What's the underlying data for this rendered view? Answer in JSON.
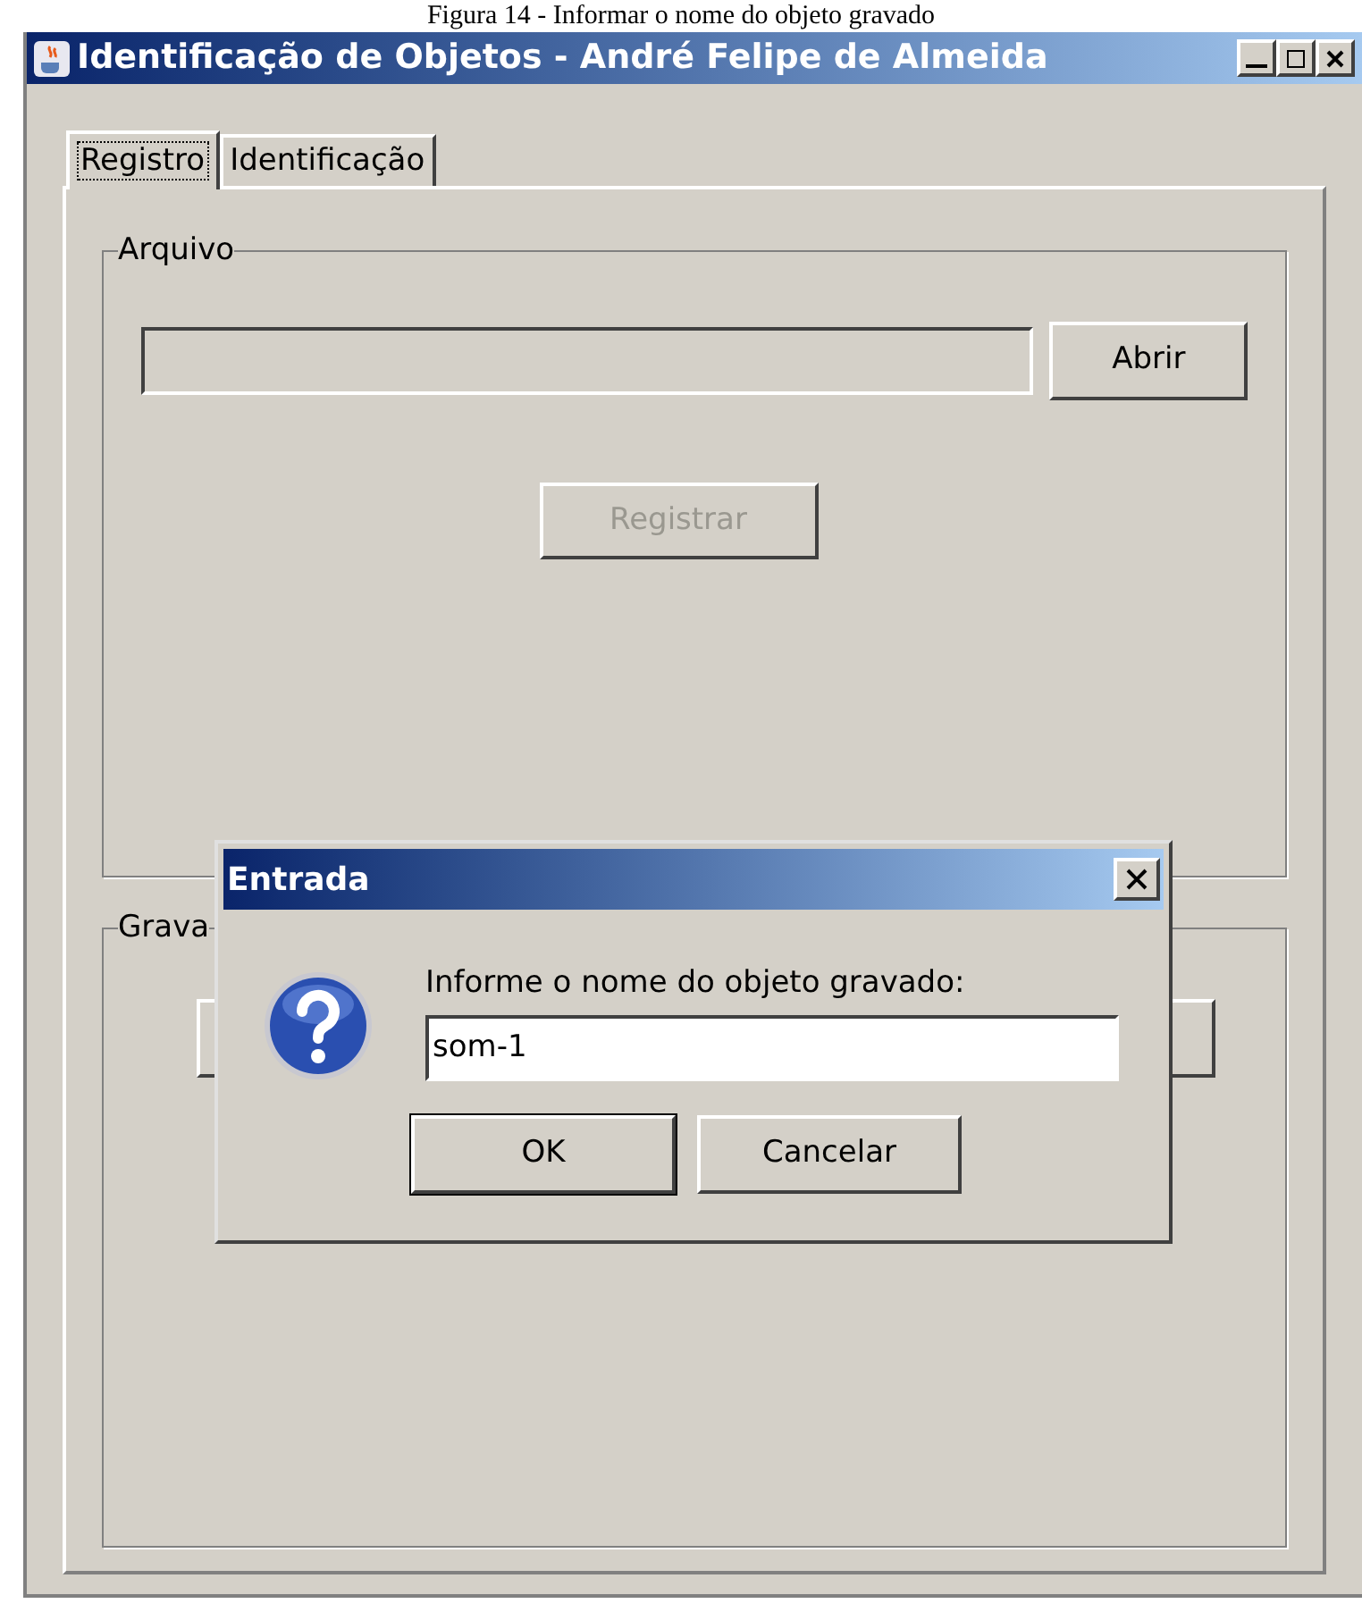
{
  "caption": "Figura 14 - Informar o nome do objeto gravado",
  "window": {
    "title": "Identificação de Objetos - André Felipe de Almeida"
  },
  "tabs": [
    {
      "label": "Registro",
      "selected": true
    },
    {
      "label": "Identificação",
      "selected": false
    }
  ],
  "arquivo_group": {
    "title": "Arquivo",
    "open_button": {
      "label": "Abrir",
      "disabled": false
    },
    "register_button": {
      "label": "Registrar",
      "disabled": true
    }
  },
  "gravacao_group": {
    "title": "Grava"
  },
  "dialog": {
    "title": "Entrada",
    "message": "Informe o nome do objeto gravado:",
    "input": {
      "value": "som-1"
    },
    "buttons": [
      {
        "label": "OK",
        "default": true
      },
      {
        "label": "Cancelar",
        "default": false
      }
    ]
  }
}
